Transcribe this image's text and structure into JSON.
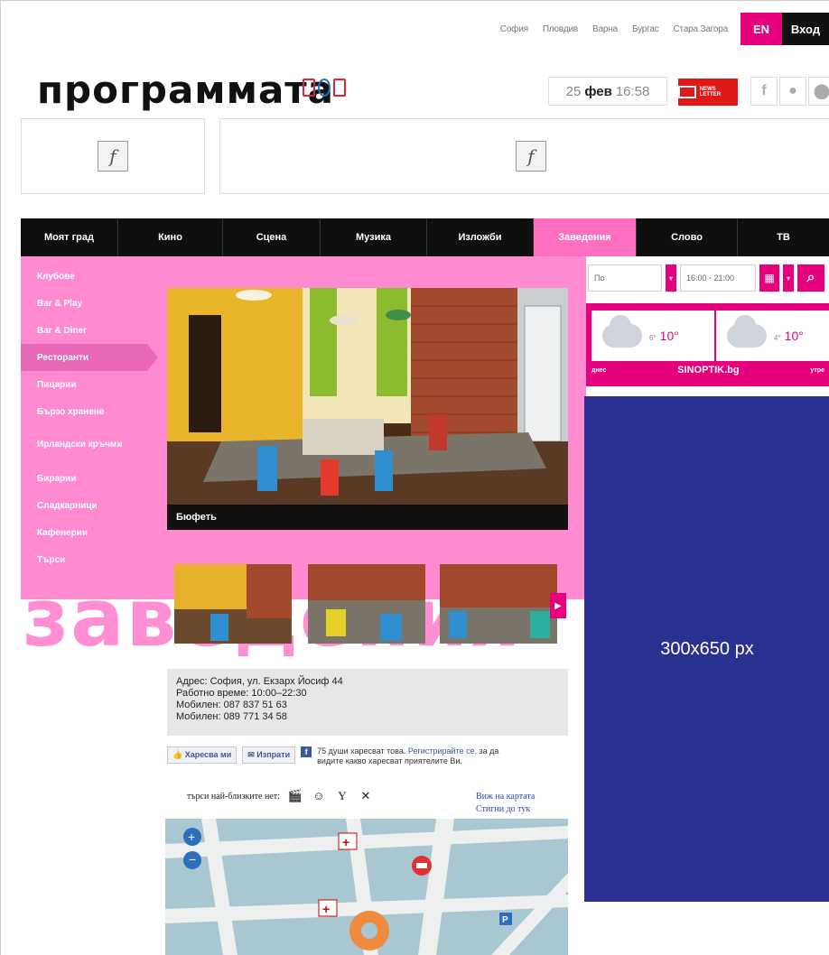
{
  "topbar": {
    "cities": [
      "София",
      "Пловдив",
      "Варна",
      "Бургас",
      "Стара Загора"
    ],
    "lang": "EN",
    "login": "Вход"
  },
  "logo": "программата",
  "date": {
    "day": "25",
    "month": "фев",
    "time": "16:58"
  },
  "newsletter": "NEWS LETTER",
  "social": [
    "f",
    "",
    "⌘"
  ],
  "nav": [
    {
      "label": "Моят град"
    },
    {
      "label": "Кино"
    },
    {
      "label": "Сцена"
    },
    {
      "label": "Музика"
    },
    {
      "label": "Изложби"
    },
    {
      "label": "Заведения",
      "active": true
    },
    {
      "label": "Слово"
    },
    {
      "label": "ТВ"
    }
  ],
  "sidebar": [
    "Клубове",
    "Bar & Play",
    "Bar & Diner",
    "Ресторанти",
    "Пицарии",
    "Бързо хранене",
    "Ирландски кръчми",
    "Бирарии",
    "Сладкарници",
    "Кафенерии",
    "Търси"
  ],
  "sidebar_active": "Ресторанти",
  "main": {
    "photo_caption": "Бюфеть",
    "big_word": "заведения"
  },
  "address": {
    "line1": "Адрес: София, ул. Екзарх Йосиф 44",
    "line2": "Работно време: 10:00–22:30",
    "line3": "Мобилен: 087 837 51 63",
    "line4": "Мобилен: 089 771 34 58"
  },
  "social_bar": {
    "like": "Харесва ми",
    "send": "Изпрати",
    "text": "75 души харесват това.",
    "link": "Регистрирайте се,",
    "text2": "за да видите какво харесват приятелите Ви."
  },
  "nearby": {
    "label": "търси най-близките нет:"
  },
  "map_links": {
    "view": "Виж на картата",
    "route": "Стигни до тук"
  },
  "search": {
    "day": "По",
    "time": "16:00 - 21:00"
  },
  "weather": {
    "cards": [
      {
        "low": "6°",
        "high": "10°"
      },
      {
        "low": "4°",
        "high": "10°"
      }
    ],
    "left_label": "днес",
    "brand": "SINOPTIK.bg",
    "right_label": "утре"
  },
  "ad": {
    "label": "300x650 px"
  },
  "colors": {
    "accent": "#e6007e",
    "pink": "#ff8ad0",
    "ad_blue": "#2a3190"
  }
}
